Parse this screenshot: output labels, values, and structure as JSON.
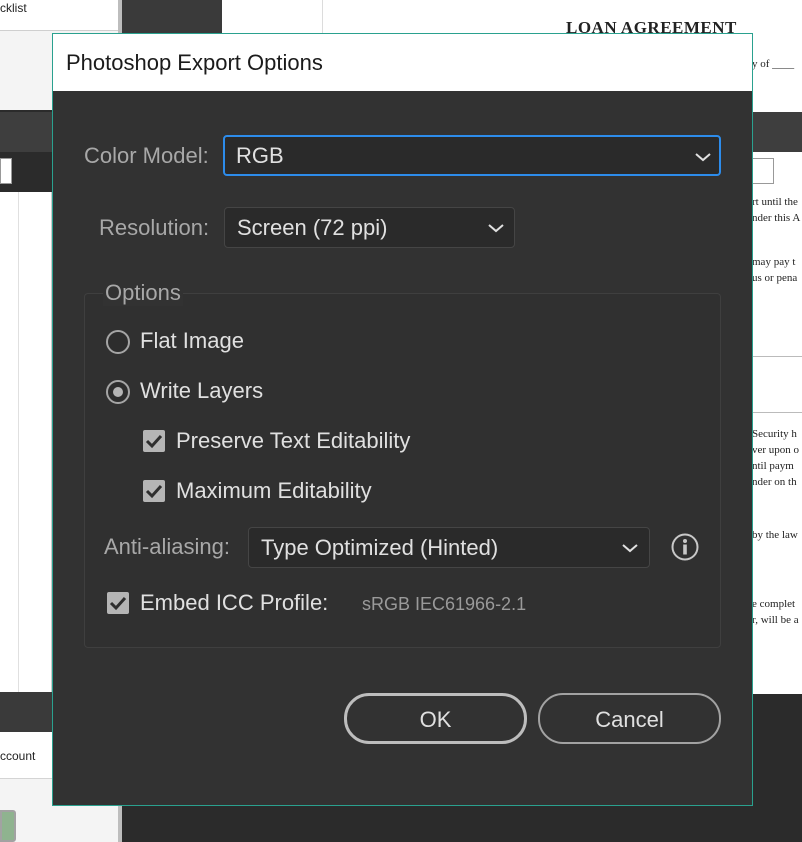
{
  "background": {
    "tab_fragment": "cklist",
    "account_fragment": "ccount",
    "doc_heading": "LOAN AGREEMENT",
    "doc_lines": [
      "y of ____",
      "rt until the",
      "nder this A",
      "may pay t",
      "us or pena",
      "Security h",
      "ver upon o",
      "ntil paym",
      "nder on th",
      "by the law",
      "e complet",
      "r, will be a"
    ]
  },
  "dialog": {
    "title": "Photoshop Export Options",
    "color_model": {
      "label": "Color Model:",
      "value": "RGB"
    },
    "resolution": {
      "label": "Resolution:",
      "value": "Screen (72 ppi)"
    },
    "options": {
      "legend": "Options",
      "flat_image": {
        "label": "Flat Image",
        "selected": false
      },
      "write_layers": {
        "label": "Write Layers",
        "selected": true
      },
      "preserve_text": {
        "label": "Preserve Text Editability",
        "checked": true
      },
      "max_edit": {
        "label": "Maximum Editability",
        "checked": true
      },
      "anti_aliasing": {
        "label": "Anti-aliasing:",
        "value": "Type Optimized (Hinted)"
      },
      "embed_icc": {
        "label": "Embed ICC Profile:",
        "value": "sRGB IEC61966-2.1",
        "checked": true
      }
    },
    "buttons": {
      "ok": "OK",
      "cancel": "Cancel"
    },
    "colors": {
      "accent_border": "#2aa18f",
      "focus_ring": "#2d8ceb",
      "panel": "#323232"
    }
  }
}
